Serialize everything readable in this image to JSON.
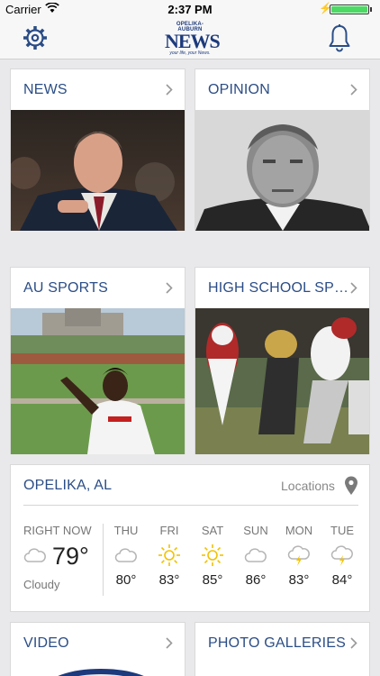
{
  "status_bar": {
    "carrier": "Carrier",
    "time": "2:37 PM",
    "battery_level": 1.0
  },
  "header": {
    "logo": {
      "masthead": "OPELIKA-AUBURN",
      "wordmark": "NEWS",
      "tagline": "your life, your News."
    },
    "settings_icon": "gear-icon",
    "notifications_icon": "bell-icon"
  },
  "sections": [
    {
      "title": "NEWS"
    },
    {
      "title": "OPINION"
    },
    {
      "title": "AU SPORTS"
    },
    {
      "title": "HIGH SCHOOL SP…"
    },
    {
      "title": "VIDEO"
    },
    {
      "title": "PHOTO GALLERIES"
    }
  ],
  "weather": {
    "city": "OPELIKA, AL",
    "locations_label": "Locations",
    "now": {
      "label": "RIGHT NOW",
      "temp": "79°",
      "condition": "Cloudy",
      "icon": "cloud-icon"
    },
    "forecast": [
      {
        "day": "THU",
        "temp": "80°",
        "icon": "cloud-icon"
      },
      {
        "day": "FRI",
        "temp": "83°",
        "icon": "sun-icon"
      },
      {
        "day": "SAT",
        "temp": "85°",
        "icon": "sun-icon"
      },
      {
        "day": "SUN",
        "temp": "86°",
        "icon": "cloud-icon"
      },
      {
        "day": "MON",
        "temp": "83°",
        "icon": "thunderstorm-icon"
      },
      {
        "day": "TUE",
        "temp": "84°",
        "icon": "thunderstorm-icon"
      }
    ]
  },
  "colors": {
    "accent": "#2b4d86",
    "sun": "#f2c200",
    "cloud": "#b5b5b5",
    "battery": "#4cd964"
  }
}
